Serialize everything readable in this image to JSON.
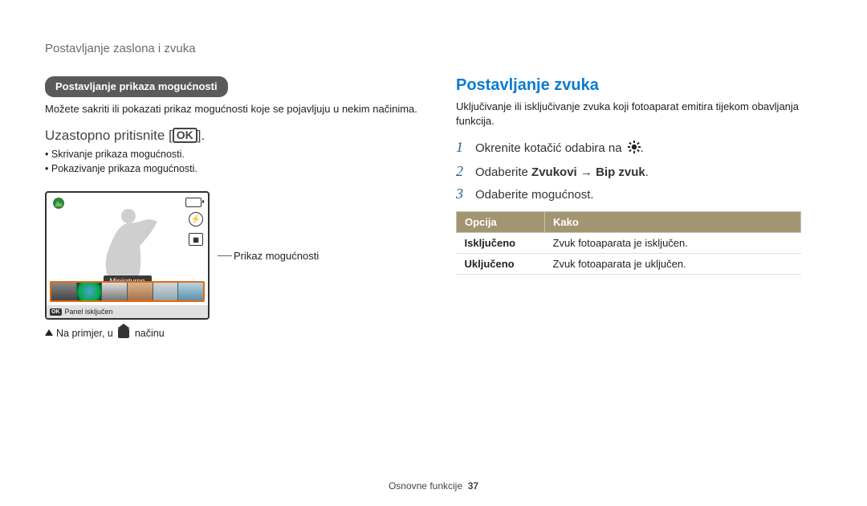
{
  "breadcrumb": "Postavljanje zaslona i zvuka",
  "left": {
    "pill": "Postavljanje prikaza mogućnosti",
    "intro": "Možete sakriti ili pokazati prikaz mogućnosti koje se pojavljuju u nekim načinima.",
    "press_prefix": "Uzastopno pritisnite [",
    "press_suffix": "].",
    "ok": "OK",
    "bullets": [
      "Skrivanje prikaza mogućnosti.",
      "Pokazivanje prikaza mogućnosti."
    ],
    "lcd": {
      "mini_label": "Minijaturno",
      "bottom_bar": "Panel isključen"
    },
    "callout": "Prikaz mogućnosti",
    "example_prefix": "Na primjer, u ",
    "example_suffix": " načinu"
  },
  "right": {
    "heading": "Postavljanje zvuka",
    "intro": "Uključivanje ili isključivanje zvuka koji fotoaparat emitira tijekom obavljanja funkcija.",
    "steps": [
      {
        "num": "1",
        "text_before": "Okrenite kotačić odabira na ",
        "text_after": ".",
        "icon": "gear"
      },
      {
        "num": "2",
        "text_before": "Odaberite ",
        "bold1": "Zvukovi",
        "arrow": " → ",
        "bold2": "Bip zvuk",
        "text_after": "."
      },
      {
        "num": "3",
        "text_before": "Odaberite mogućnost."
      }
    ],
    "table": {
      "head": [
        "Opcija",
        "Kako"
      ],
      "rows": [
        [
          "Isključeno",
          "Zvuk fotoaparata je isključen."
        ],
        [
          "Uključeno",
          "Zvuk fotoaparata je uključen."
        ]
      ]
    }
  },
  "footer": {
    "section": "Osnovne funkcije",
    "page": "37"
  }
}
